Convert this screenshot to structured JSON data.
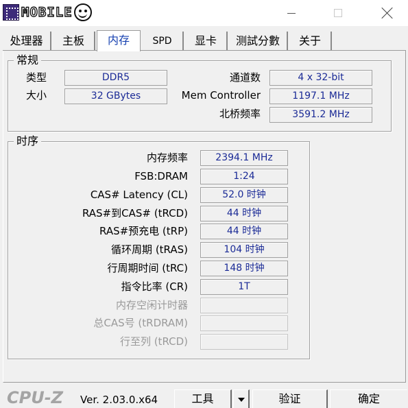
{
  "window": {
    "logo_text": "MOBILE"
  },
  "tabs": [
    {
      "label": "处理器"
    },
    {
      "label": "主板"
    },
    {
      "label": "内存"
    },
    {
      "label": "SPD"
    },
    {
      "label": "显卡"
    },
    {
      "label": "测試分數"
    },
    {
      "label": "关于"
    }
  ],
  "active_tab": "内存",
  "general": {
    "title": "常规",
    "type_label": "类型",
    "type_value": "DDR5",
    "size_label": "大小",
    "size_value": "32 GBytes",
    "channels_label": "通道数",
    "channels_value": "4 x 32-bit",
    "mem_controller_label": "Mem Controller",
    "mem_controller_value": "1197.1 MHz",
    "nb_freq_label": "北桥频率",
    "nb_freq_value": "3591.2 MHz"
  },
  "timings": {
    "title": "时序",
    "rows": [
      {
        "label": "内存频率",
        "value": "2394.1 MHz",
        "enabled": true
      },
      {
        "label": "FSB:DRAM",
        "value": "1:24",
        "enabled": true
      },
      {
        "label": "CAS# Latency (CL)",
        "value": "52.0 时钟",
        "enabled": true
      },
      {
        "label": "RAS#到CAS# (tRCD)",
        "value": "44 时钟",
        "enabled": true
      },
      {
        "label": "RAS#预充电 (tRP)",
        "value": "44 时钟",
        "enabled": true
      },
      {
        "label": "循环周期 (tRAS)",
        "value": "104 时钟",
        "enabled": true
      },
      {
        "label": "行周期时间 (tRC)",
        "value": "148 时钟",
        "enabled": true
      },
      {
        "label": "指令比率 (CR)",
        "value": "1T",
        "enabled": true
      },
      {
        "label": "内存空闲计时器",
        "value": "",
        "enabled": false
      },
      {
        "label": "总CAS号 (tRDRAM)",
        "value": "",
        "enabled": false
      },
      {
        "label": "行至列 (tRCD)",
        "value": "",
        "enabled": false
      }
    ]
  },
  "footer": {
    "brand": "CPU-Z",
    "version": "Ver. 2.03.0.x64",
    "tools_label": "工具",
    "validate_label": "验证",
    "ok_label": "确定"
  },
  "colors": {
    "value_text": "#1a2a96",
    "active_tab_text": "#1540b0",
    "disabled_text": "#9a9a9a"
  },
  "icons": [
    "minimize-icon",
    "maximize-icon",
    "close-icon",
    "dropdown-arrow-icon"
  ]
}
